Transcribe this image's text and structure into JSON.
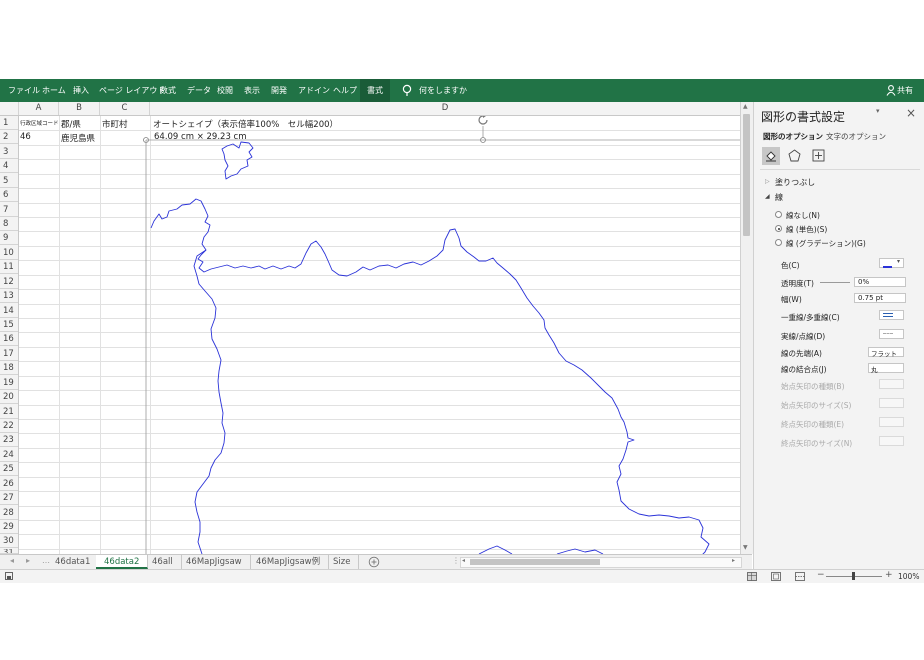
{
  "ribbon": {
    "tabs": [
      "ファイル",
      "ホーム",
      "挿入",
      "ページ レイアウト",
      "数式",
      "データ",
      "校閲",
      "表示",
      "開発",
      "アドイン",
      "ヘルプ"
    ],
    "active_tab": "書式",
    "tell_me": "何をしますか",
    "share": "共有"
  },
  "sheet": {
    "columns": [
      "A",
      "B",
      "C",
      "D"
    ],
    "rows": [
      "1",
      "2",
      "3",
      "4",
      "5",
      "6",
      "7",
      "8",
      "9",
      "10",
      "11",
      "12",
      "13",
      "14",
      "15",
      "16",
      "17",
      "18",
      "19",
      "20",
      "21",
      "22",
      "23",
      "24",
      "25",
      "26",
      "27",
      "28",
      "29",
      "30",
      "31"
    ],
    "cells": {
      "A1": "行政区域コード",
      "B1": "郡/県",
      "C1": "市町村",
      "D1": "オートシェイプ（表示倍率100%　セル幅200）",
      "A2": "46",
      "B2": "鹿児島県",
      "D2": "64.09 cm × 29.23 cm"
    }
  },
  "sheet_tabs": [
    "46data1",
    "46data2",
    "46all",
    "46MapJigsaw",
    "46MapJigsaw例",
    "Size"
  ],
  "active_sheet": "46data2",
  "status": {
    "zoom": "100%"
  },
  "pane": {
    "title": "図形の書式設定",
    "tabs": [
      "図形のオプション",
      "文字のオプション"
    ],
    "fill_section": "塗りつぶし",
    "line_section": "線",
    "line_options": [
      "線なし(N)",
      "線 (単色)(S)",
      "線 (グラデーション)(G)"
    ],
    "selected_line_option": "線 (単色)(S)",
    "props": {
      "color": "色(C)",
      "transparency": "透明度(T)",
      "transparency_value": "0%",
      "width": "幅(W)",
      "width_value": "0.75 pt",
      "compound": "一重線/多重線(C)",
      "dash": "実線/点線(D)",
      "cap": "線の先端(A)",
      "cap_value": "フラット",
      "join": "線の結合点(J)",
      "join_value": "丸",
      "begin_arrow_type": "始点矢印の種類(B)",
      "begin_arrow_size": "始点矢印のサイズ(S)",
      "end_arrow_type": "終点矢印の種類(E)",
      "end_arrow_size": "終点矢印のサイズ(N)"
    }
  },
  "colors": {
    "accent": "#217346",
    "outline": "#2a32d8"
  },
  "icons": [
    "lightbulb-icon",
    "person-icon",
    "close-icon",
    "paint-bucket-icon",
    "pentagon-icon",
    "size-icon",
    "rotate-handle-icon",
    "add-sheet-icon"
  ]
}
